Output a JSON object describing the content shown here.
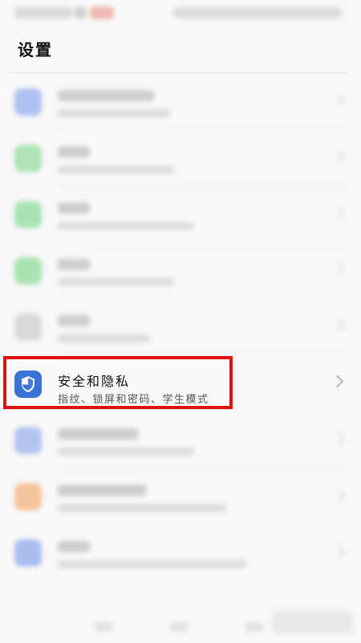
{
  "header": {
    "title": "设置"
  },
  "security_item": {
    "title": "安全和隐私",
    "subtitle": "指纹、锁屏和密码、学生模式",
    "icon": "shield-icon"
  },
  "colors": {
    "highlight_border": "#e30f0f",
    "security_icon_bg": "#3a73d6"
  },
  "blurred_items": [
    {
      "icon_color": "#aebff1"
    },
    {
      "icon_color": "#aee3b6"
    },
    {
      "icon_color": "#a9e2b4"
    },
    {
      "icon_color": "#abe2b1"
    },
    {
      "icon_color": "#d9d9d9"
    },
    {
      "icon_color": "#b3c4f0"
    },
    {
      "icon_color": "#f6c29b"
    },
    {
      "icon_color": "#a9bdf1"
    }
  ]
}
